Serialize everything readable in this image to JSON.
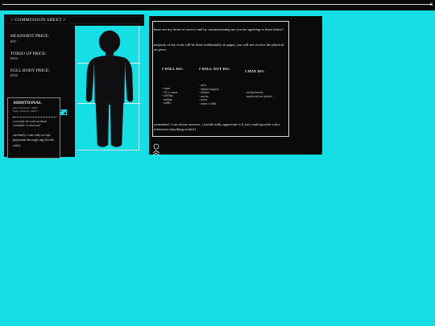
{
  "window": {
    "close_glyph": "x"
  },
  "left_panel": {
    "title": "// COMMISSION SHEET //",
    "prices": [
      {
        "label": "HEADSHOT PRICE:",
        "value": "RM7"
      },
      {
        "label": "TORSO UP PRICE:",
        "value": "RM10"
      },
      {
        "label": "FULL BODY PRICE:",
        "value": "RM20"
      }
    ],
    "additional": {
      "heading": "ADDITIONAL",
      "line1": "extra character : RM5",
      "line2": "fully coloured : RM7+",
      "medium": "currently the only medium available is charcoal",
      "payment": "currently i can only accept payments through tng (locals only)."
    }
  },
  "figure": {
    "icon": "person-silhouette-icon",
    "color": "#0f0f12"
  },
  "terms": {
    "intro": "these are my terms of service and by commissioning me you are agreeing to these below!",
    "traditional": "majority of my work will be done traditionally on paper, you will not receive the physical art piece",
    "will_do": {
      "heading": "I WILL DO:",
      "items": [
        "- fanart",
        "- OC x canon",
        "- self/dap",
        "- selfdap",
        "- nudity"
      ]
    },
    "will_not_do": {
      "heading": "I WILL NOT DO:",
      "items": [
        "- nsfw",
        "- hateful imagery",
        "- realism",
        "- mecha",
        "- incest",
        "- minor x adult"
      ]
    },
    "may_do": {
      "heading": "I MAY DO:",
      "items": [
        "- sticker/emotes",
        "- maybe ask me about it"
      ]
    },
    "closing": "remember! i can refuse services, i would really appreciate it if you could provide a few references (anything works!)"
  },
  "colors": {
    "background": "#15dfe4",
    "panel": "#0a0a0a",
    "text": "#e8e8e8"
  }
}
